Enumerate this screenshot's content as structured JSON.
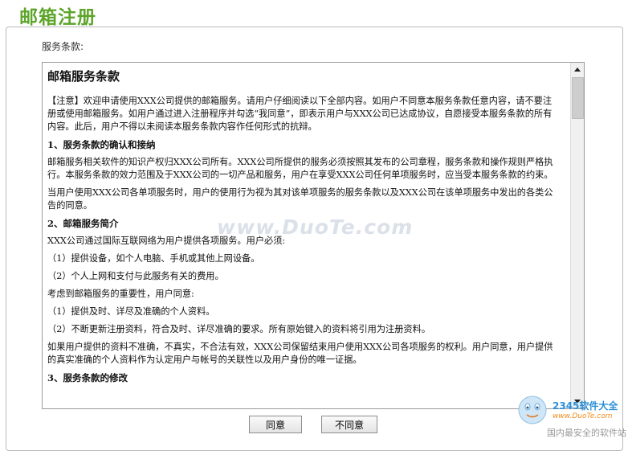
{
  "page_title": "邮箱注册",
  "section_label": "服务条款:",
  "terms": {
    "heading": "邮箱服务条款",
    "intro": "【注意】欢迎申请使用XXX公司提供的邮箱服务。请用户仔细阅读以下全部内容。如用户不同意本服务条款任意内容，请不要注册或使用邮箱服务。如用户通过进入注册程序并勾选“我同意”，即表示用户与XXX公司已达成协议，自愿接受本服务条款的所有内容。此后，用户不得以未阅读本服务条款内容作任何形式的抗辩。",
    "s1_title": "1、服务条款的确认和接纳",
    "s1_p1": "邮箱服务相关软件的知识产权归XXX公司所有。XXX公司所提供的服务必须按照其发布的公司章程，服务条款和操作规则严格执行。本服务条款的效力范围及于XXX公司的一切产品和服务，用户在享受XXX公司任何单项服务时，应当受本服务条款的约束。",
    "s1_p2": "当用户使用XXX公司各单项服务时，用户的使用行为视为其对该单项服务的服务条款以及XXX公司在该单项服务中发出的各类公告的同意。",
    "s2_title": "2、邮箱服务简介",
    "s2_p1": "XXX公司通过国际互联网络为用户提供各项服务。用户必须:",
    "s2_l1": "（1）提供设备，如个人电脑、手机或其他上网设备。",
    "s2_l2": "（2）个人上网和支付与此服务有关的费用。",
    "s2_p2": "考虑到邮箱服务的重要性，用户同意:",
    "s2_l3": "（1）提供及时、详尽及准确的个人资料。",
    "s2_l4": "（2）不断更新注册资料，符合及时、详尽准确的要求。所有原始键入的资料将引用为注册资料。",
    "s2_p3": "如果用户提供的资料不准确，不真实，不合法有效，XXX公司保留结束用户使用XXX公司各项服务的权利。用户同意，用户提供的真实准确的个人资料作为认定用户与帐号的关联性以及用户身份的唯一证据。",
    "s3_title": "3、服务条款的修改"
  },
  "buttons": {
    "agree": "同意",
    "disagree": "不同意"
  },
  "watermark": "www.DuoTe.com",
  "brand": {
    "name": "2345软件大全",
    "url": "www.DuoTe.com",
    "slogan": "国内最安全的软件站"
  },
  "colors": {
    "title_green": "#5ea52c",
    "brand_blue": "#2a8fd6",
    "brand_orange": "#f08a1a"
  }
}
